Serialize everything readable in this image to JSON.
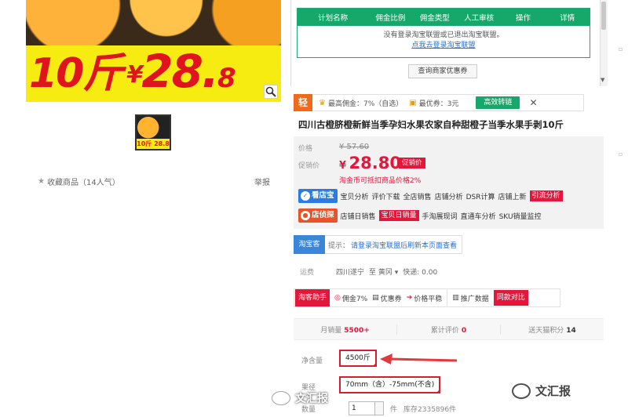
{
  "hero": {
    "promo_weight": "10斤",
    "promo_yen": "¥",
    "promo_price_big": "28.",
    "promo_price_small": "8"
  },
  "thumbnail": {
    "caption": "10斤 28.8"
  },
  "favorites": {
    "label": "收藏商品（14人气）"
  },
  "report": {
    "label": "举报"
  },
  "commission_table": {
    "headers": [
      "计划名称",
      "佣金比例",
      "佣金类型",
      "人工审核",
      "操作",
      "详情"
    ],
    "empty_message": "没有登录淘宝联盟或已退出淘宝联盟。",
    "login_link": "点我去登录淘宝联盟",
    "query_button": "查询商家优惠券"
  },
  "commission_bar": {
    "logo": "轻",
    "highest": "最高佣金：7%（自选）",
    "best": "最优券：3元",
    "convert_button": "高效转链",
    "close": "✕"
  },
  "product": {
    "title": "四川古橙脐橙新鲜当季孕妇水果农家自种甜橙子当季水果手剥10斤"
  },
  "price": {
    "label_price": "价格",
    "old_price": "¥ 57.60",
    "label_promo": "促销价",
    "now_symbol": "¥",
    "now_value": "28.80",
    "promo_tag": "促销价",
    "rebate_note": "淘金币可抵扣商品价格2%"
  },
  "tools1": {
    "badge": "看店宝",
    "links": [
      "宝贝分析",
      "评价下载",
      "全店销售",
      "店铺分析",
      "DSR计算",
      "店铺上新"
    ],
    "highlight": "引流分析"
  },
  "tools2": {
    "badge": "店侦探",
    "links": [
      "店铺日销售"
    ],
    "highlight": "宝贝日销量",
    "links2": [
      "手淘展现词",
      "直通车分析",
      "SKU销量监控"
    ]
  },
  "tip": {
    "logo": "淘宝客",
    "label": "提示：",
    "link": "请登录淘宝联盟后刷新本页面查看"
  },
  "shipping": {
    "label": "运费",
    "from": "四川遂宁",
    "to": "至 黄冈 ▾",
    "express": "快递: 0.00"
  },
  "helper": {
    "button": "淘客助手",
    "commission": "佣金7%",
    "coupon": "优惠券",
    "price_trend": "价格平稳",
    "promo_data": "推广数据",
    "compare": "同款对比"
  },
  "stats": {
    "monthly_label": "月销量",
    "monthly_value": "5500+",
    "reviews_label": "累计评价",
    "reviews_value": "0",
    "points_label": "送天猫积分",
    "points_value": "14"
  },
  "options": {
    "net_label": "净含量",
    "net_value": "4500斤",
    "size_label": "果径",
    "size_value": "70mm（含）-75mm(不含)"
  },
  "quantity": {
    "label": "数量",
    "value": "1",
    "unit": "件",
    "stock": "库存2335896件"
  },
  "watermark": {
    "left": "文汇报",
    "right": "文汇报"
  },
  "colors": {
    "accent_red": "#e4163a",
    "green": "#16a86a",
    "blue": "#2c7be0",
    "orange": "#e8542a"
  }
}
